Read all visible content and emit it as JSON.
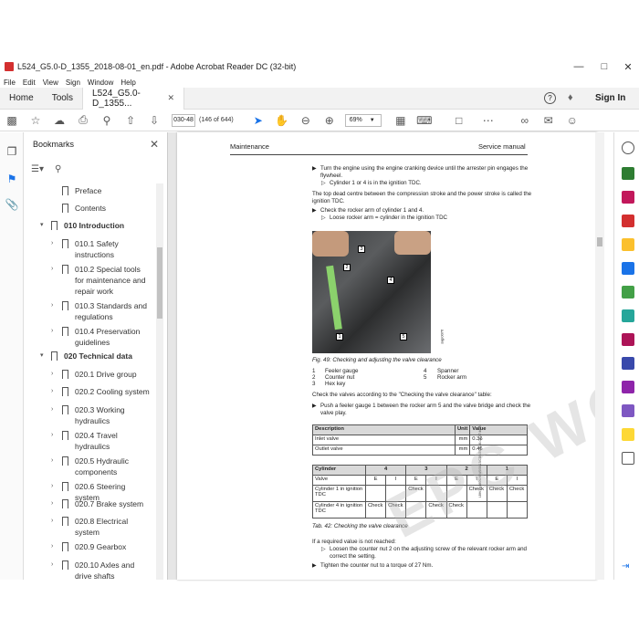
{
  "window": {
    "title": "L524_G5.0-D_1355_2018-08-01_en.pdf - Adobe Acrobat Reader DC (32-bit)"
  },
  "menu": [
    "File",
    "Edit",
    "View",
    "Sign",
    "Window",
    "Help"
  ],
  "tabs": {
    "home": "Home",
    "tools": "Tools",
    "document": "L524_G5.0-D_1355...",
    "sign_in": "Sign In"
  },
  "toolbar": {
    "page_input": "030-48",
    "page_count": "(146 of 644)",
    "zoom": "69%"
  },
  "bookmarks": {
    "title": "Bookmarks",
    "items": [
      {
        "label": "Preface",
        "level": 1,
        "expandable": false
      },
      {
        "label": "Contents",
        "level": 1,
        "expandable": false
      },
      {
        "label": "010 Introduction",
        "level": 0,
        "expandable": true,
        "expanded": true
      },
      {
        "label": "010.1 Safety instructions",
        "level": 1,
        "expandable": true
      },
      {
        "label": "010.2 Special tools for maintenance and repair work",
        "level": 1,
        "expandable": true
      },
      {
        "label": "010.3 Standards and regulations",
        "level": 1,
        "expandable": true
      },
      {
        "label": "010.4 Preservation guidelines",
        "level": 1,
        "expandable": true
      },
      {
        "label": "020 Technical data",
        "level": 0,
        "expandable": true,
        "expanded": true
      },
      {
        "label": "020.1 Drive group",
        "level": 1,
        "expandable": true
      },
      {
        "label": "020.2 Cooling system",
        "level": 1,
        "expandable": true
      },
      {
        "label": "020.3 Working hydraulics",
        "level": 1,
        "expandable": true
      },
      {
        "label": "020.4 Travel hydraulics",
        "level": 1,
        "expandable": true
      },
      {
        "label": "020.5 Hydraulic components",
        "level": 1,
        "expandable": true
      },
      {
        "label": "020.6 Steering system",
        "level": 1,
        "expandable": true
      },
      {
        "label": "020.7 Brake system",
        "level": 1,
        "expandable": true
      },
      {
        "label": "020.8 Electrical system",
        "level": 1,
        "expandable": true
      },
      {
        "label": "020.9 Gearbox",
        "level": 1,
        "expandable": true
      },
      {
        "label": "020.10 Axles and drive shafts",
        "level": 1,
        "expandable": true
      }
    ]
  },
  "page": {
    "header_left": "Maintenance",
    "header_right": "Service manual",
    "step1": "Turn the engine using the engine cranking device until the arrester pin engages the flywheel.",
    "step1_result": "Cylinder 1 or 4 is in the ignition TDC.",
    "para1": "The top dead centre between the compression stroke and the power stroke is called the ignition TDC.",
    "step2": "Check the rocker arm of cylinder 1 and 4.",
    "step2_result": "Loose rocker arm = cylinder in the ignition TDC",
    "photo_code": "sxjp0076",
    "fig_caption": "Fig. 49: Checking and adjusting the valve clearance",
    "legend": [
      {
        "num": "1",
        "text": "Feeler gauge"
      },
      {
        "num": "2",
        "text": "Counter nut"
      },
      {
        "num": "3",
        "text": "Hex key"
      },
      {
        "num": "4",
        "text": "Spanner"
      },
      {
        "num": "5",
        "text": "Rocker arm"
      }
    ],
    "para2": "Check the valves according to the \"Checking the valve clearance\" table:",
    "step3": "Push a feeler gauge 1 between the rocker arm 5 and the valve bridge and check the valve play.",
    "table1": {
      "headers": [
        "Description",
        "Unit",
        "Value"
      ],
      "rows": [
        [
          "Inlet valve",
          "mm",
          "0.36"
        ],
        [
          "Outlet valve",
          "mm",
          "0.46"
        ]
      ]
    },
    "table2": {
      "header_row": [
        "Cylinder",
        "4",
        "3",
        "2",
        "1"
      ],
      "valve_row": [
        "Valve",
        "E",
        "I",
        "E",
        "I",
        "E",
        "I",
        "E",
        "I"
      ],
      "rows": [
        [
          "Cylinder 1 in ignition TDC",
          "",
          "",
          "Check",
          "",
          "",
          "Check",
          "Check",
          "Check"
        ],
        [
          "Cylinder 4 in ignition TDC",
          "Check",
          "Check",
          "",
          "Check",
          "Check",
          "",
          "",
          ""
        ]
      ]
    },
    "side_code": "LBH/10446002/EN/0/09.13/CDR/2018-08-01_07:46:04",
    "tab_caption": "Tab. 42: Checking the valve clearance",
    "para3": "If a required value is not reached:",
    "step4": "Loosen the counter nut 2 on the adjusting screw of the relevant rocker arm and correct the setting.",
    "step5": "Tighten the counter nut to a torque of 27 Nm.",
    "watermark": "EPC  WO.COM"
  },
  "colors": {
    "accent": "#1a73e8",
    "pdf_red": "#d32f2f"
  }
}
